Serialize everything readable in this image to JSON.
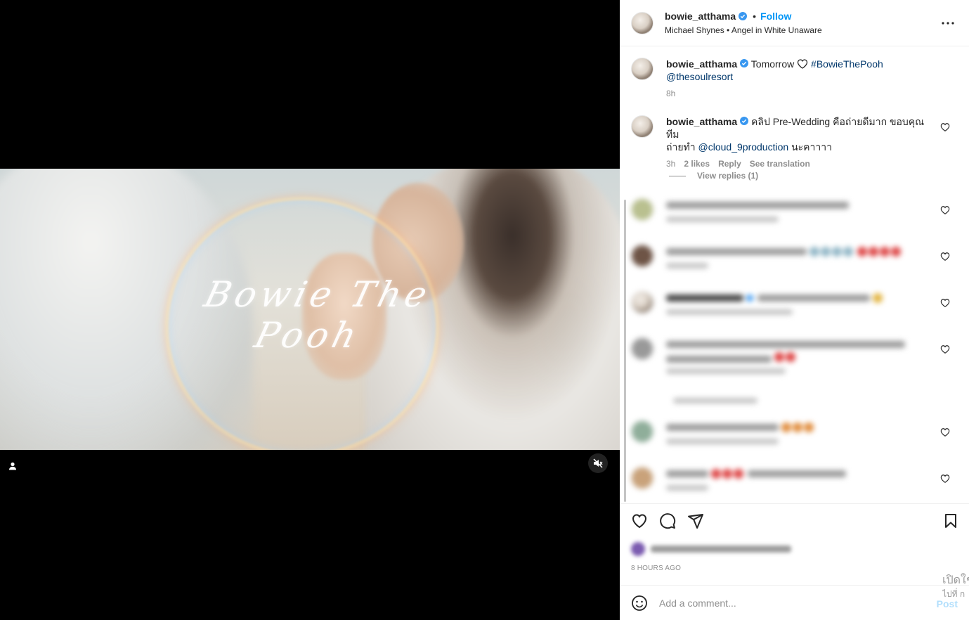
{
  "media": {
    "overlay_title": "Bowie The Pooh"
  },
  "header": {
    "username": "bowie_atthama",
    "separator": "•",
    "follow_label": "Follow",
    "audio": "Michael Shynes • Angel in White Unaware"
  },
  "caption": {
    "username": "bowie_atthama",
    "text": "Tomorrow",
    "hashtag": "#BowieThePooh",
    "mention": "@thesoulresort",
    "time": "8h"
  },
  "pinned_comment": {
    "username": "bowie_atthama",
    "text_1": "คลิป Pre-Wedding คือถ่ายดีมาก ขอบคุณทีม",
    "text_2": "ถ่ายทำ",
    "mention": "@cloud_9production",
    "text_3": "นะคาาาา",
    "time": "3h",
    "likes": "2 likes",
    "reply_label": "Reply",
    "translate_label": "See translation",
    "view_replies": "View replies (1)"
  },
  "actions": {
    "posted_ago": "8 hours ago"
  },
  "add_comment": {
    "placeholder": "Add a comment...",
    "post_label": "Post"
  },
  "watermark": {
    "line1": "เปิดใช",
    "line2": "ไปที่ ก"
  },
  "colors": {
    "accent": "#0095f6",
    "link": "#00376b",
    "muted": "#8e8e8e"
  }
}
